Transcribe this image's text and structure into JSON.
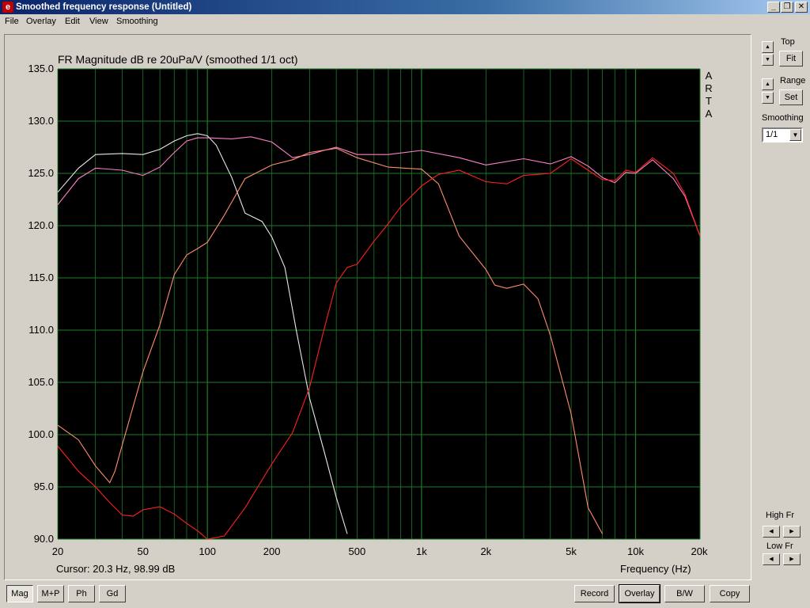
{
  "window": {
    "title": "Smoothed frequency response (Untitled)",
    "minimize": "_",
    "restore": "❐",
    "close": "✕"
  },
  "menu": [
    "File",
    "Overlay",
    "Edit",
    "View",
    "Smoothing"
  ],
  "plot": {
    "title": "FR Magnitude dB re 20uPa/V (smoothed 1/1 oct)",
    "watermark": [
      "A",
      "R",
      "T",
      "A"
    ],
    "cursor_readout": "Cursor: 20.3 Hz, 98.99 dB",
    "x_axis_label": "Frequency (Hz)"
  },
  "controls": {
    "top_label": "Top",
    "fit_label": "Fit",
    "range_label": "Range",
    "set_label": "Set",
    "smoothing_label": "Smoothing",
    "smoothing_value": "1/1",
    "high_fr_label": "High Fr",
    "low_fr_label": "Low Fr"
  },
  "bottom_left_buttons": [
    "Mag",
    "M+P",
    "Ph",
    "Gd"
  ],
  "bottom_right_buttons": [
    "Record",
    "Overlay",
    "B/W",
    "Copy"
  ],
  "colors": {
    "plot_bg": "#000000",
    "grid": "#1e7a2a",
    "white_curve": "#e8e8e8",
    "pink_curve": "#ff7fc8",
    "salmon_curve": "#ff8c6e",
    "red_curve": "#ff2020"
  },
  "chart_data": {
    "type": "line",
    "title": "FR Magnitude dB re 20uPa/V (smoothed 1/1 oct)",
    "xlabel": "Frequency (Hz)",
    "ylabel": "",
    "x_scale": "log",
    "xlim": [
      20,
      20000
    ],
    "ylim": [
      90,
      135
    ],
    "x_ticks": [
      20,
      50,
      100,
      200,
      500,
      1000,
      2000,
      5000,
      10000,
      20000
    ],
    "x_tick_labels": [
      "20",
      "50",
      "100",
      "200",
      "500",
      "1k",
      "2k",
      "5k",
      "10k",
      "20k"
    ],
    "y_ticks": [
      90,
      95,
      100,
      105,
      110,
      115,
      120,
      125,
      130,
      135
    ],
    "y_tick_labels": [
      "90.0",
      "95.0",
      "100.0",
      "105.0",
      "110.0",
      "115.0",
      "120.0",
      "125.0",
      "130.0",
      "135.0"
    ],
    "grid": true,
    "series": [
      {
        "color": "#e8e8e8",
        "x": [
          20,
          25,
          30,
          40,
          50,
          60,
          70,
          80,
          90,
          100,
          110,
          130,
          150,
          180,
          200,
          230,
          260,
          300,
          350,
          400,
          450
        ],
        "y": [
          123.2,
          125.5,
          126.8,
          126.9,
          126.8,
          127.3,
          128.1,
          128.6,
          128.8,
          128.6,
          127.7,
          124.6,
          121.2,
          120.4,
          118.9,
          116.0,
          110.0,
          103.5,
          98.5,
          94.0,
          90.5
        ]
      },
      {
        "color": "#ff7fc8",
        "x": [
          20,
          25,
          30,
          40,
          50,
          60,
          70,
          80,
          90,
          100,
          130,
          160,
          200,
          250,
          300,
          350,
          400,
          500,
          700,
          1000,
          1500,
          2000,
          3000,
          4000,
          5000,
          6000,
          7000,
          8000,
          9000,
          10000,
          12000,
          15000,
          17000,
          20000
        ],
        "y": [
          122.0,
          124.5,
          125.5,
          125.3,
          124.8,
          125.6,
          127.0,
          128.1,
          128.4,
          128.4,
          128.3,
          128.5,
          128.0,
          126.5,
          126.8,
          127.2,
          127.5,
          126.8,
          126.8,
          127.2,
          126.5,
          125.8,
          126.4,
          125.9,
          126.6,
          125.7,
          124.6,
          124.1,
          125.1,
          125.0,
          126.3,
          124.5,
          122.8,
          119.0
        ]
      },
      {
        "color": "#ff8c6e",
        "x": [
          20,
          25,
          30,
          35,
          37,
          40,
          50,
          60,
          70,
          80,
          90,
          100,
          120,
          150,
          200,
          250,
          300,
          400,
          500,
          700,
          1000,
          1200,
          1500,
          2000,
          2200,
          2500,
          3000,
          3500,
          4000,
          5000,
          6000,
          7000
        ],
        "y": [
          100.9,
          99.5,
          97.0,
          95.4,
          96.5,
          99.0,
          106.0,
          110.5,
          115.3,
          117.2,
          117.8,
          118.4,
          121.0,
          124.5,
          125.8,
          126.3,
          127.0,
          127.4,
          126.5,
          125.6,
          125.4,
          124.0,
          119.0,
          115.8,
          114.3,
          114.0,
          114.4,
          113.0,
          109.5,
          102.0,
          93.0,
          90.5
        ]
      },
      {
        "color": "#ff2020",
        "x": [
          20,
          25,
          30,
          35,
          40,
          45,
          50,
          60,
          70,
          80,
          90,
          100,
          120,
          150,
          200,
          250,
          300,
          350,
          400,
          450,
          500,
          600,
          700,
          800,
          1000,
          1200,
          1500,
          2000,
          2500,
          3000,
          4000,
          5000,
          6000,
          7000,
          8000,
          9000,
          10000,
          12000,
          15000,
          17000,
          20000
        ],
        "y": [
          98.9,
          96.5,
          95.0,
          93.5,
          92.3,
          92.2,
          92.8,
          93.1,
          92.4,
          91.5,
          90.8,
          90.0,
          90.3,
          93.0,
          97.2,
          100.2,
          104.5,
          110.0,
          114.5,
          116.0,
          116.3,
          118.5,
          120.2,
          121.8,
          123.8,
          124.9,
          125.3,
          124.2,
          124.0,
          124.8,
          125.0,
          126.4,
          125.3,
          124.4,
          124.3,
          125.3,
          125.1,
          126.5,
          125.0,
          123.0,
          119.0
        ]
      }
    ]
  }
}
